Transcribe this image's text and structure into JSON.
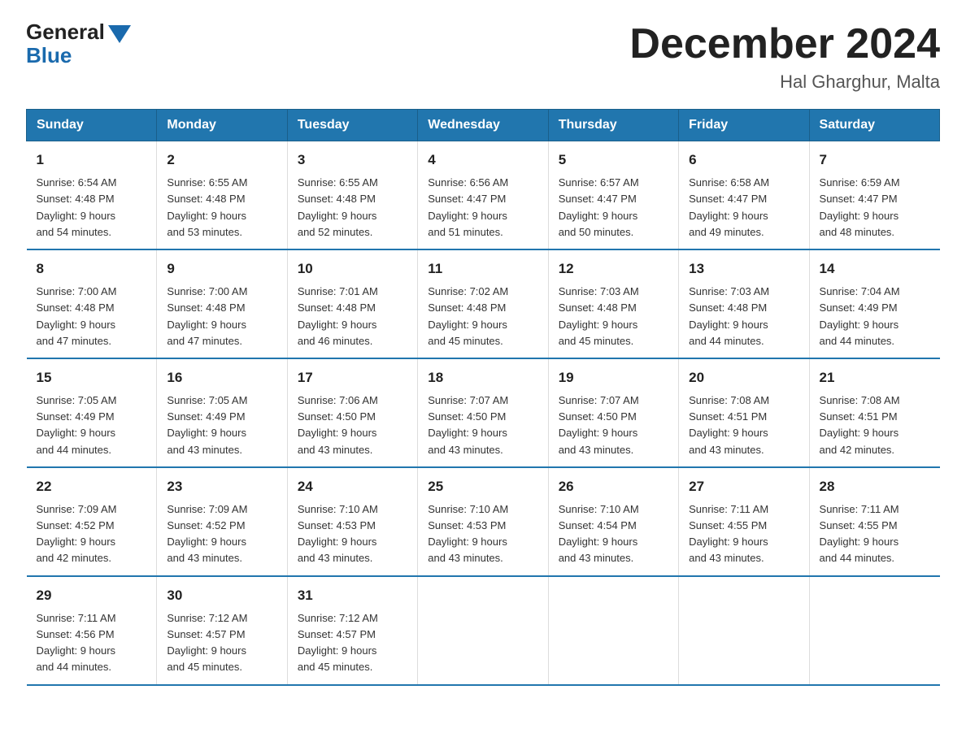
{
  "header": {
    "logo_general": "General",
    "logo_blue": "Blue",
    "month_title": "December 2024",
    "location": "Hal Gharghur, Malta"
  },
  "weekdays": [
    "Sunday",
    "Monday",
    "Tuesday",
    "Wednesday",
    "Thursday",
    "Friday",
    "Saturday"
  ],
  "weeks": [
    [
      {
        "day": "1",
        "info": "Sunrise: 6:54 AM\nSunset: 4:48 PM\nDaylight: 9 hours\nand 54 minutes."
      },
      {
        "day": "2",
        "info": "Sunrise: 6:55 AM\nSunset: 4:48 PM\nDaylight: 9 hours\nand 53 minutes."
      },
      {
        "day": "3",
        "info": "Sunrise: 6:55 AM\nSunset: 4:48 PM\nDaylight: 9 hours\nand 52 minutes."
      },
      {
        "day": "4",
        "info": "Sunrise: 6:56 AM\nSunset: 4:47 PM\nDaylight: 9 hours\nand 51 minutes."
      },
      {
        "day": "5",
        "info": "Sunrise: 6:57 AM\nSunset: 4:47 PM\nDaylight: 9 hours\nand 50 minutes."
      },
      {
        "day": "6",
        "info": "Sunrise: 6:58 AM\nSunset: 4:47 PM\nDaylight: 9 hours\nand 49 minutes."
      },
      {
        "day": "7",
        "info": "Sunrise: 6:59 AM\nSunset: 4:47 PM\nDaylight: 9 hours\nand 48 minutes."
      }
    ],
    [
      {
        "day": "8",
        "info": "Sunrise: 7:00 AM\nSunset: 4:48 PM\nDaylight: 9 hours\nand 47 minutes."
      },
      {
        "day": "9",
        "info": "Sunrise: 7:00 AM\nSunset: 4:48 PM\nDaylight: 9 hours\nand 47 minutes."
      },
      {
        "day": "10",
        "info": "Sunrise: 7:01 AM\nSunset: 4:48 PM\nDaylight: 9 hours\nand 46 minutes."
      },
      {
        "day": "11",
        "info": "Sunrise: 7:02 AM\nSunset: 4:48 PM\nDaylight: 9 hours\nand 45 minutes."
      },
      {
        "day": "12",
        "info": "Sunrise: 7:03 AM\nSunset: 4:48 PM\nDaylight: 9 hours\nand 45 minutes."
      },
      {
        "day": "13",
        "info": "Sunrise: 7:03 AM\nSunset: 4:48 PM\nDaylight: 9 hours\nand 44 minutes."
      },
      {
        "day": "14",
        "info": "Sunrise: 7:04 AM\nSunset: 4:49 PM\nDaylight: 9 hours\nand 44 minutes."
      }
    ],
    [
      {
        "day": "15",
        "info": "Sunrise: 7:05 AM\nSunset: 4:49 PM\nDaylight: 9 hours\nand 44 minutes."
      },
      {
        "day": "16",
        "info": "Sunrise: 7:05 AM\nSunset: 4:49 PM\nDaylight: 9 hours\nand 43 minutes."
      },
      {
        "day": "17",
        "info": "Sunrise: 7:06 AM\nSunset: 4:50 PM\nDaylight: 9 hours\nand 43 minutes."
      },
      {
        "day": "18",
        "info": "Sunrise: 7:07 AM\nSunset: 4:50 PM\nDaylight: 9 hours\nand 43 minutes."
      },
      {
        "day": "19",
        "info": "Sunrise: 7:07 AM\nSunset: 4:50 PM\nDaylight: 9 hours\nand 43 minutes."
      },
      {
        "day": "20",
        "info": "Sunrise: 7:08 AM\nSunset: 4:51 PM\nDaylight: 9 hours\nand 43 minutes."
      },
      {
        "day": "21",
        "info": "Sunrise: 7:08 AM\nSunset: 4:51 PM\nDaylight: 9 hours\nand 42 minutes."
      }
    ],
    [
      {
        "day": "22",
        "info": "Sunrise: 7:09 AM\nSunset: 4:52 PM\nDaylight: 9 hours\nand 42 minutes."
      },
      {
        "day": "23",
        "info": "Sunrise: 7:09 AM\nSunset: 4:52 PM\nDaylight: 9 hours\nand 43 minutes."
      },
      {
        "day": "24",
        "info": "Sunrise: 7:10 AM\nSunset: 4:53 PM\nDaylight: 9 hours\nand 43 minutes."
      },
      {
        "day": "25",
        "info": "Sunrise: 7:10 AM\nSunset: 4:53 PM\nDaylight: 9 hours\nand 43 minutes."
      },
      {
        "day": "26",
        "info": "Sunrise: 7:10 AM\nSunset: 4:54 PM\nDaylight: 9 hours\nand 43 minutes."
      },
      {
        "day": "27",
        "info": "Sunrise: 7:11 AM\nSunset: 4:55 PM\nDaylight: 9 hours\nand 43 minutes."
      },
      {
        "day": "28",
        "info": "Sunrise: 7:11 AM\nSunset: 4:55 PM\nDaylight: 9 hours\nand 44 minutes."
      }
    ],
    [
      {
        "day": "29",
        "info": "Sunrise: 7:11 AM\nSunset: 4:56 PM\nDaylight: 9 hours\nand 44 minutes."
      },
      {
        "day": "30",
        "info": "Sunrise: 7:12 AM\nSunset: 4:57 PM\nDaylight: 9 hours\nand 45 minutes."
      },
      {
        "day": "31",
        "info": "Sunrise: 7:12 AM\nSunset: 4:57 PM\nDaylight: 9 hours\nand 45 minutes."
      },
      {
        "day": "",
        "info": ""
      },
      {
        "day": "",
        "info": ""
      },
      {
        "day": "",
        "info": ""
      },
      {
        "day": "",
        "info": ""
      }
    ]
  ]
}
